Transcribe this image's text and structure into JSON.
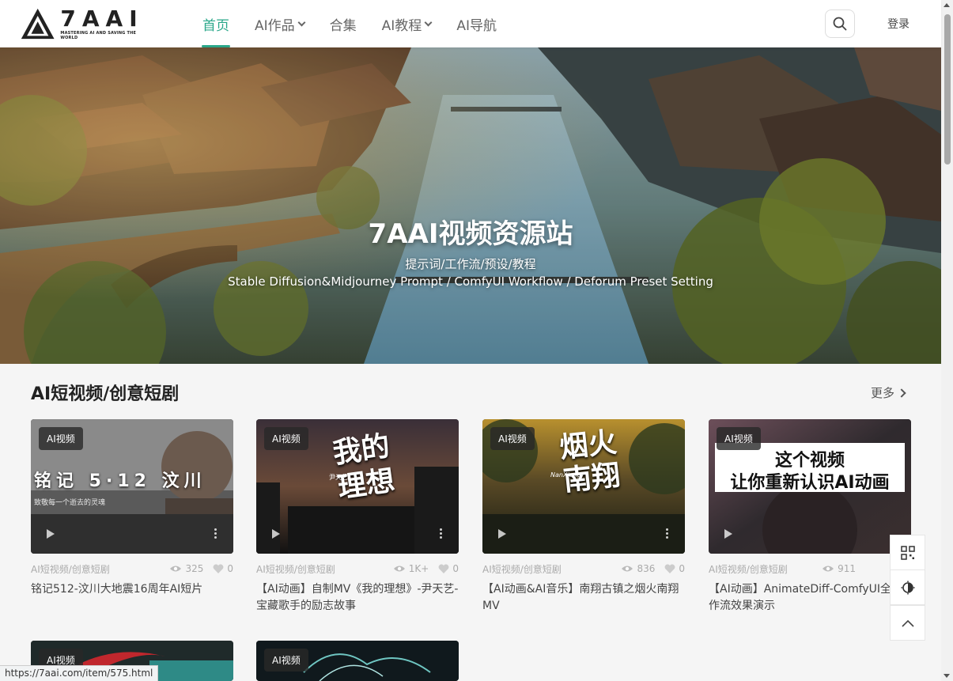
{
  "logo": {
    "main": "7AAI",
    "sub": "MASTERING AI AND SAVING THE WORLD"
  },
  "nav": [
    {
      "label": "首页",
      "active": true,
      "dropdown": false
    },
    {
      "label": "AI作品",
      "active": false,
      "dropdown": true
    },
    {
      "label": "合集",
      "active": false,
      "dropdown": false
    },
    {
      "label": "AI教程",
      "active": false,
      "dropdown": true
    },
    {
      "label": "AI导航",
      "active": false,
      "dropdown": false
    }
  ],
  "header": {
    "login": "登录",
    "search_icon": "search-icon"
  },
  "hero": {
    "title": "7AAI视频资源站",
    "subtitle1": "提示词/工作流/预设/教程",
    "subtitle2": "Stable Diffusion&Midjourney Prompt / ComfyUI Workflow / Deforum Preset Setting"
  },
  "section": {
    "title": "AI短视频/创意短剧",
    "more": "更多"
  },
  "cards": [
    {
      "tag": "AI视频",
      "category": "AI短视频/创意短剧",
      "views": "325",
      "likes": "0",
      "title": "铭记512-汶川大地震16周年AI短片",
      "thumb_text": "铭记 5·12 汶川",
      "thumb_sub": "致敬每一个逝去的灵魂"
    },
    {
      "tag": "AI视频",
      "category": "AI短视频/创意短剧",
      "views": "1K+",
      "likes": "0",
      "title": "【AI动画】自制MV《我的理想》-尹天艺-宝藏歌手的励志故事",
      "thumb_text": "我的理想",
      "thumb_sub": "尹天艺"
    },
    {
      "tag": "AI视频",
      "category": "AI短视频/创意短剧",
      "views": "836",
      "likes": "0",
      "title": "【AI动画&AI音乐】南翔古镇之烟火南翔MV",
      "thumb_text": "烟火南翔",
      "thumb_sub": "NanXiang"
    },
    {
      "tag": "AI视频",
      "category": "AI短视频/创意短剧",
      "views": "911",
      "likes": "",
      "title": "【AI动画】AnimateDiff-ComfyUI全工作流效果演示",
      "thumb_text": "这个视频",
      "thumb_sub": "让你重新认识AI动画"
    }
  ],
  "row2_tags": [
    "AI视频",
    "AI视频"
  ],
  "status_url": "https://7aai.com/item/575.html",
  "colors": {
    "accent": "#2aa78a"
  }
}
